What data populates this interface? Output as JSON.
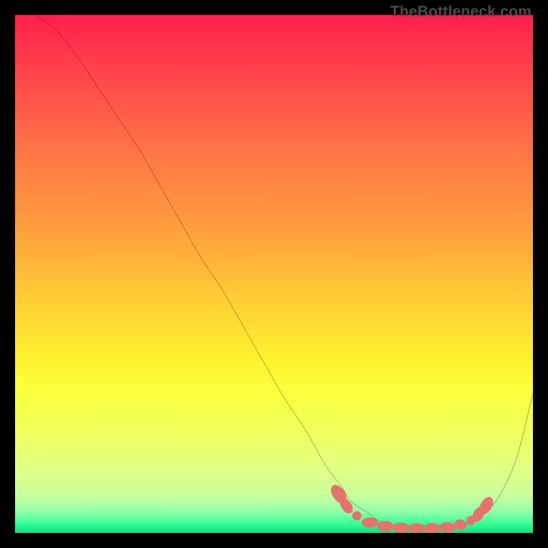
{
  "watermark": "TheBottleneck.com",
  "chart_data": {
    "type": "line",
    "title": "",
    "xlabel": "",
    "ylabel": "",
    "xlim": [
      0,
      100
    ],
    "ylim": [
      0,
      100
    ],
    "grid": false,
    "legend": false,
    "series": [
      {
        "name": "curve",
        "color": "#000000",
        "x": [
          4,
          8,
          12,
          16,
          20,
          24,
          28,
          32,
          36,
          40,
          44,
          48,
          52,
          56,
          60,
          63,
          65,
          68,
          70,
          73,
          76,
          79,
          82,
          85,
          88,
          91,
          94,
          97,
          100
        ],
        "y": [
          100,
          97,
          92,
          86,
          80,
          74,
          67,
          60,
          53,
          47,
          40,
          33,
          26,
          20,
          13,
          9,
          6,
          4,
          2.5,
          1.5,
          1,
          0.8,
          0.8,
          1,
          2,
          4,
          8,
          15,
          27
        ]
      }
    ],
    "markers": [
      {
        "cx": 62.5,
        "cy": 7.5,
        "rx": 1.2,
        "ry": 2.0,
        "rot": -35
      },
      {
        "cx": 64.0,
        "cy": 5.2,
        "rx": 1.0,
        "ry": 1.6,
        "rot": -35
      },
      {
        "cx": 66.0,
        "cy": 3.3,
        "rx": 0.9,
        "ry": 0.9,
        "rot": 0
      },
      {
        "cx": 68.5,
        "cy": 2.0,
        "rx": 1.6,
        "ry": 1.0,
        "rot": 0
      },
      {
        "cx": 71.5,
        "cy": 1.3,
        "rx": 1.6,
        "ry": 1.0,
        "rot": 0
      },
      {
        "cx": 74.5,
        "cy": 1.0,
        "rx": 1.6,
        "ry": 1.0,
        "rot": 0
      },
      {
        "cx": 77.5,
        "cy": 0.9,
        "rx": 1.6,
        "ry": 1.0,
        "rot": 0
      },
      {
        "cx": 80.5,
        "cy": 0.9,
        "rx": 1.6,
        "ry": 1.0,
        "rot": 0
      },
      {
        "cx": 83.5,
        "cy": 1.1,
        "rx": 1.6,
        "ry": 1.0,
        "rot": 0
      },
      {
        "cx": 86.0,
        "cy": 1.6,
        "rx": 1.2,
        "ry": 1.0,
        "rot": 10
      },
      {
        "cx": 88.0,
        "cy": 2.4,
        "rx": 0.9,
        "ry": 0.9,
        "rot": 0
      },
      {
        "cx": 89.5,
        "cy": 3.6,
        "rx": 1.0,
        "ry": 1.6,
        "rot": 30
      },
      {
        "cx": 91.0,
        "cy": 5.3,
        "rx": 1.1,
        "ry": 1.8,
        "rot": 30
      }
    ],
    "marker_color": "#e5736c",
    "background_gradient": {
      "type": "vertical",
      "stops": [
        {
          "pos": 0.0,
          "color": "#ff1f4b"
        },
        {
          "pos": 0.4,
          "color": "#ff943f"
        },
        {
          "pos": 0.7,
          "color": "#fff02f"
        },
        {
          "pos": 0.9,
          "color": "#d8ff90"
        },
        {
          "pos": 1.0,
          "color": "#00e77a"
        }
      ]
    }
  }
}
